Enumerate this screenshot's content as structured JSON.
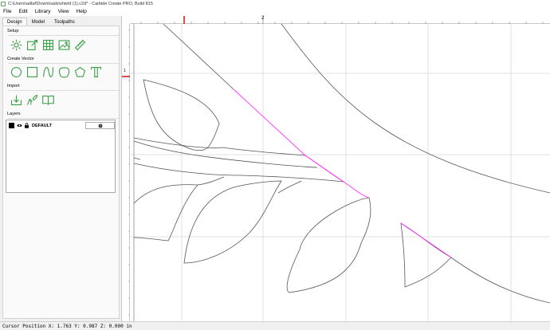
{
  "window": {
    "title": "C:\\Users\\adlaf\\Downloads\\shield (1).c2d* - Carbide Create PRO, Build 815"
  },
  "menu": [
    "File",
    "Edit",
    "Library",
    "View",
    "Help"
  ],
  "tabs": [
    "Design",
    "Model",
    "Toolpaths"
  ],
  "sections": {
    "setup": "Setup",
    "create_vector": "Create Vector",
    "import": "Import",
    "layers": "Layers"
  },
  "setup_tools": [
    "job-setup-icon",
    "select-node-icon",
    "grid-table-icon",
    "image-icon",
    "measure-ruler-icon"
  ],
  "vector_tools": [
    "circle-icon",
    "rectangle-icon",
    "curve-icon",
    "polygon-blob-icon",
    "pentagon-icon",
    "text-icon"
  ],
  "import_tools": [
    "import-download-icon",
    "import-trace-icon",
    "open-book-icon"
  ],
  "layers": [
    {
      "name": "DEFAULT",
      "color": "#000000",
      "visible": true,
      "locked": true
    }
  ],
  "rulers": {
    "top_label": "2",
    "left_label": "1"
  },
  "colors": {
    "accent_green": "#3ca046",
    "selection_magenta": "#ff33ff",
    "ruler_marker": "#cc0000",
    "grid": "#d9d9d9"
  },
  "status": {
    "cursor_position": "Cursor Position X: 1.763 Y: 0.987 Z: 0.000 in"
  }
}
